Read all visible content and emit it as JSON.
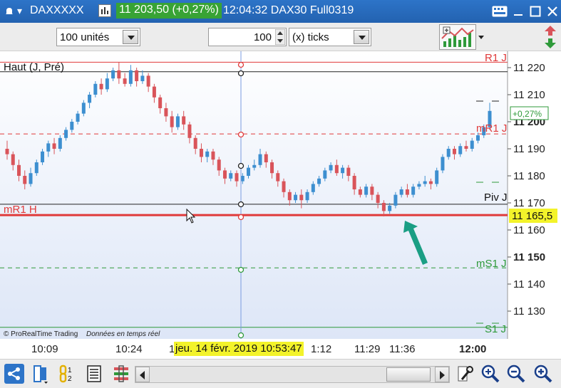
{
  "titlebar": {
    "ticker": "DAXXXXX",
    "price_badge": "11 203,50 (+0,27%)",
    "time_label": "12:04:32 DAX30 Full0319"
  },
  "toolbar": {
    "units_select": "100 unités",
    "ticks_value": "100",
    "ticks_select": "(x) ticks"
  },
  "chart": {
    "label_haut": "Haut (J, Pré)",
    "label_r1j": "R1 J",
    "label_mr1j": "mR1 J",
    "label_pivj": "Piv J",
    "label_mr1h": "mR1 H",
    "label_ms1j": "mS1 J",
    "label_s1j": "S1 J",
    "copyright": "© ProRealTime Trading",
    "realtime": "Données en temps réel",
    "pct_badge": "+0,27%",
    "price_tag": "11 165,5",
    "y_ticks": [
      "11 220",
      "11 210",
      "11 200",
      "11 190",
      "11 180",
      "11 170",
      "11 160",
      "11 150",
      "11 140",
      "11 130"
    ],
    "y_bold": [
      "11 200",
      "11 150"
    ],
    "colors": {
      "up": "#3d8fd0",
      "down": "#d9545a",
      "resistance": "#e03a3a",
      "support": "#2f9a3a",
      "pivot": "#222222",
      "arrow": "#1a9e84"
    }
  },
  "time_axis": {
    "labels": [
      "10:09",
      "10:24",
      "1",
      "1:12",
      "11:29",
      "11:36",
      "12:00"
    ],
    "cursor_date": "jeu. 14 févr. 2019 10:53:47"
  },
  "chart_data": {
    "type": "candlestick",
    "y_range": [
      11123,
      11226
    ],
    "levels": [
      {
        "name": "R1 J",
        "value": 11222
      },
      {
        "name": "Haut (J, Pré)",
        "value": 11218.5
      },
      {
        "name": "mR1 J",
        "value": 11195.5
      },
      {
        "name": "Piv J",
        "value": 11169.5
      },
      {
        "name": "mR1 H",
        "value": 11165.5
      },
      {
        "name": "mS1 J",
        "value": 11146
      },
      {
        "name": "S1 J",
        "value": 11124
      }
    ],
    "candles": [
      [
        11190,
        11188,
        11193,
        11186
      ],
      [
        11188,
        11184,
        11189,
        11182
      ],
      [
        11184,
        11180,
        11186,
        11178
      ],
      [
        11180,
        11177,
        11182,
        11175
      ],
      [
        11177,
        11181,
        11183,
        11176
      ],
      [
        11181,
        11185,
        11186,
        11180
      ],
      [
        11185,
        11189,
        11190,
        11184
      ],
      [
        11189,
        11192,
        11193,
        11187
      ],
      [
        11192,
        11190,
        11194,
        11188
      ],
      [
        11190,
        11194,
        11195,
        11189
      ],
      [
        11194,
        11197,
        11198,
        11193
      ],
      [
        11197,
        11200,
        11201,
        11196
      ],
      [
        11200,
        11203,
        11204,
        11199
      ],
      [
        11203,
        11207,
        11208,
        11202
      ],
      [
        11207,
        11210,
        11211,
        11205
      ],
      [
        11210,
        11214,
        11215,
        11209
      ],
      [
        11214,
        11212,
        11216,
        11210
      ],
      [
        11212,
        11216,
        11218,
        11211
      ],
      [
        11216,
        11219,
        11220,
        11215
      ],
      [
        11219,
        11216,
        11222,
        11214
      ],
      [
        11216,
        11214,
        11218,
        11213
      ],
      [
        11214,
        11219,
        11221,
        11213
      ],
      [
        11219,
        11215,
        11220,
        11213
      ],
      [
        11215,
        11217,
        11219,
        11214
      ],
      [
        11217,
        11213,
        11218,
        11211
      ],
      [
        11213,
        11209,
        11214,
        11207
      ],
      [
        11209,
        11205,
        11210,
        11203
      ],
      [
        11205,
        11202,
        11207,
        11200
      ],
      [
        11202,
        11198,
        11204,
        11196
      ],
      [
        11198,
        11202,
        11203,
        11197
      ],
      [
        11202,
        11199,
        11204,
        11197
      ],
      [
        11199,
        11194,
        11200,
        11192
      ],
      [
        11194,
        11190,
        11195,
        11188
      ],
      [
        11190,
        11187,
        11192,
        11185
      ],
      [
        11187,
        11189,
        11190,
        11185
      ],
      [
        11189,
        11186,
        11190,
        11184
      ],
      [
        11186,
        11182,
        11187,
        11180
      ],
      [
        11182,
        11179,
        11183,
        11177
      ],
      [
        11179,
        11181,
        11182,
        11178
      ],
      [
        11181,
        11178,
        11182,
        11176
      ],
      [
        11178,
        11180,
        11181,
        11177
      ],
      [
        11180,
        11183,
        11184,
        11179
      ],
      [
        11183,
        11184,
        11186,
        11182
      ],
      [
        11184,
        11188,
        11190,
        11183
      ],
      [
        11188,
        11185,
        11189,
        11183
      ],
      [
        11185,
        11181,
        11186,
        11179
      ],
      [
        11181,
        11178,
        11182,
        11176
      ],
      [
        11178,
        11174,
        11179,
        11172
      ],
      [
        11174,
        11171,
        11175,
        11169
      ],
      [
        11171,
        11173,
        11174,
        11170
      ],
      [
        11173,
        11171,
        11175,
        11168
      ],
      [
        11171,
        11174,
        11175,
        11170
      ],
      [
        11174,
        11177,
        11178,
        11173
      ],
      [
        11177,
        11179,
        11180,
        11176
      ],
      [
        11179,
        11182,
        11183,
        11178
      ],
      [
        11182,
        11184,
        11185,
        11181
      ],
      [
        11184,
        11181,
        11186,
        11180
      ],
      [
        11181,
        11183,
        11184,
        11179
      ],
      [
        11183,
        11180,
        11184,
        11178
      ],
      [
        11180,
        11175,
        11181,
        11173
      ],
      [
        11175,
        11173,
        11176,
        11172
      ],
      [
        11173,
        11176,
        11177,
        11172
      ],
      [
        11176,
        11173,
        11177,
        11171
      ],
      [
        11173,
        11170,
        11174,
        11168
      ],
      [
        11170,
        11167,
        11171,
        11165
      ],
      [
        11167,
        11169,
        11170,
        11166
      ],
      [
        11169,
        11173,
        11174,
        11168
      ],
      [
        11173,
        11175,
        11176,
        11172
      ],
      [
        11175,
        11173,
        11177,
        11172
      ],
      [
        11173,
        11176,
        11177,
        11172
      ],
      [
        11176,
        11177,
        11178,
        11175
      ],
      [
        11177,
        11178,
        11180,
        11176
      ],
      [
        11178,
        11177,
        11179,
        11175
      ],
      [
        11177,
        11182,
        11183,
        11176
      ],
      [
        11182,
        11187,
        11188,
        11181
      ],
      [
        11187,
        11190,
        11191,
        11186
      ],
      [
        11190,
        11188,
        11191,
        11186
      ],
      [
        11188,
        11191,
        11192,
        11187
      ],
      [
        11191,
        11190,
        11193,
        11189
      ],
      [
        11190,
        11193,
        11194,
        11189
      ],
      [
        11193,
        11195,
        11196,
        11192
      ],
      [
        11195,
        11198,
        11199,
        11194
      ],
      [
        11198,
        11204,
        11207,
        11197
      ]
    ]
  }
}
